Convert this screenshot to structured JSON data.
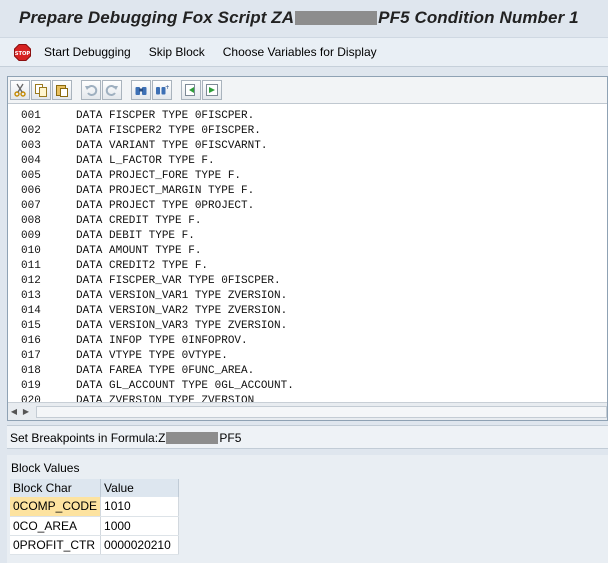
{
  "window": {
    "title_prefix": "Prepare Debugging Fox Script ZA",
    "title_suffix": "PF5 Condition Number 1"
  },
  "app_toolbar": {
    "icon": "stop-icon",
    "start_debugging": "Start Debugging",
    "skip_block": "Skip Block",
    "choose_variables": "Choose Variables for Display"
  },
  "editor_toolbar": {
    "icons": [
      "cut-icon",
      "copy-icon",
      "paste-icon",
      "undo-icon",
      "redo-icon",
      "find-icon",
      "find-next-icon",
      "load-icon",
      "save-icon"
    ]
  },
  "code_lines": [
    {
      "num": "001",
      "text": "DATA FISCPER TYPE 0FISCPER."
    },
    {
      "num": "002",
      "text": "DATA FISCPER2 TYPE 0FISCPER."
    },
    {
      "num": "003",
      "text": "DATA VARIANT TYPE 0FISCVARNT."
    },
    {
      "num": "004",
      "text": "DATA L_FACTOR TYPE F."
    },
    {
      "num": "005",
      "text": "DATA PROJECT_FORE TYPE F."
    },
    {
      "num": "006",
      "text": "DATA PROJECT_MARGIN TYPE F."
    },
    {
      "num": "007",
      "text": "DATA PROJECT TYPE 0PROJECT."
    },
    {
      "num": "008",
      "text": "DATA CREDIT TYPE F."
    },
    {
      "num": "009",
      "text": "DATA DEBIT TYPE F."
    },
    {
      "num": "010",
      "text": "DATA AMOUNT TYPE F."
    },
    {
      "num": "011",
      "text": "DATA CREDIT2 TYPE F."
    },
    {
      "num": "012",
      "text": "DATA FISCPER_VAR TYPE 0FISCPER."
    },
    {
      "num": "013",
      "text": "DATA VERSION_VAR1 TYPE ZVERSION."
    },
    {
      "num": "014",
      "text": "DATA VERSION_VAR2 TYPE ZVERSION."
    },
    {
      "num": "015",
      "text": "DATA VERSION_VAR3 TYPE ZVERSION."
    },
    {
      "num": "016",
      "text": "DATA INFOP TYPE 0INFOPROV."
    },
    {
      "num": "017",
      "text": "DATA VTYPE TYPE 0VTYPE."
    },
    {
      "num": "018",
      "text": "DATA FAREA TYPE 0FUNC_AREA."
    },
    {
      "num": "019",
      "text": "DATA GL_ACCOUNT TYPE 0GL_ACCOUNT."
    },
    {
      "num": "020",
      "text": "DATA ZVERSION TYPE ZVERSION"
    }
  ],
  "breakpoints": {
    "label_prefix": "Set Breakpoints in Formula:Z",
    "label_suffix": "PF5"
  },
  "block_values": {
    "title": "Block Values",
    "headers": [
      "Block Char",
      "Value"
    ],
    "rows": [
      {
        "char": "0COMP_CODE",
        "value": "1010",
        "selected": true
      },
      {
        "char": "0CO_AREA",
        "value": "1000",
        "selected": false
      },
      {
        "char": "0PROFIT_CTR",
        "value": "0000020210",
        "selected": false
      }
    ]
  },
  "colors": {
    "background": "#dfe6ee",
    "selected_cell": "#fde3a0",
    "stop_red": "#d62222"
  }
}
